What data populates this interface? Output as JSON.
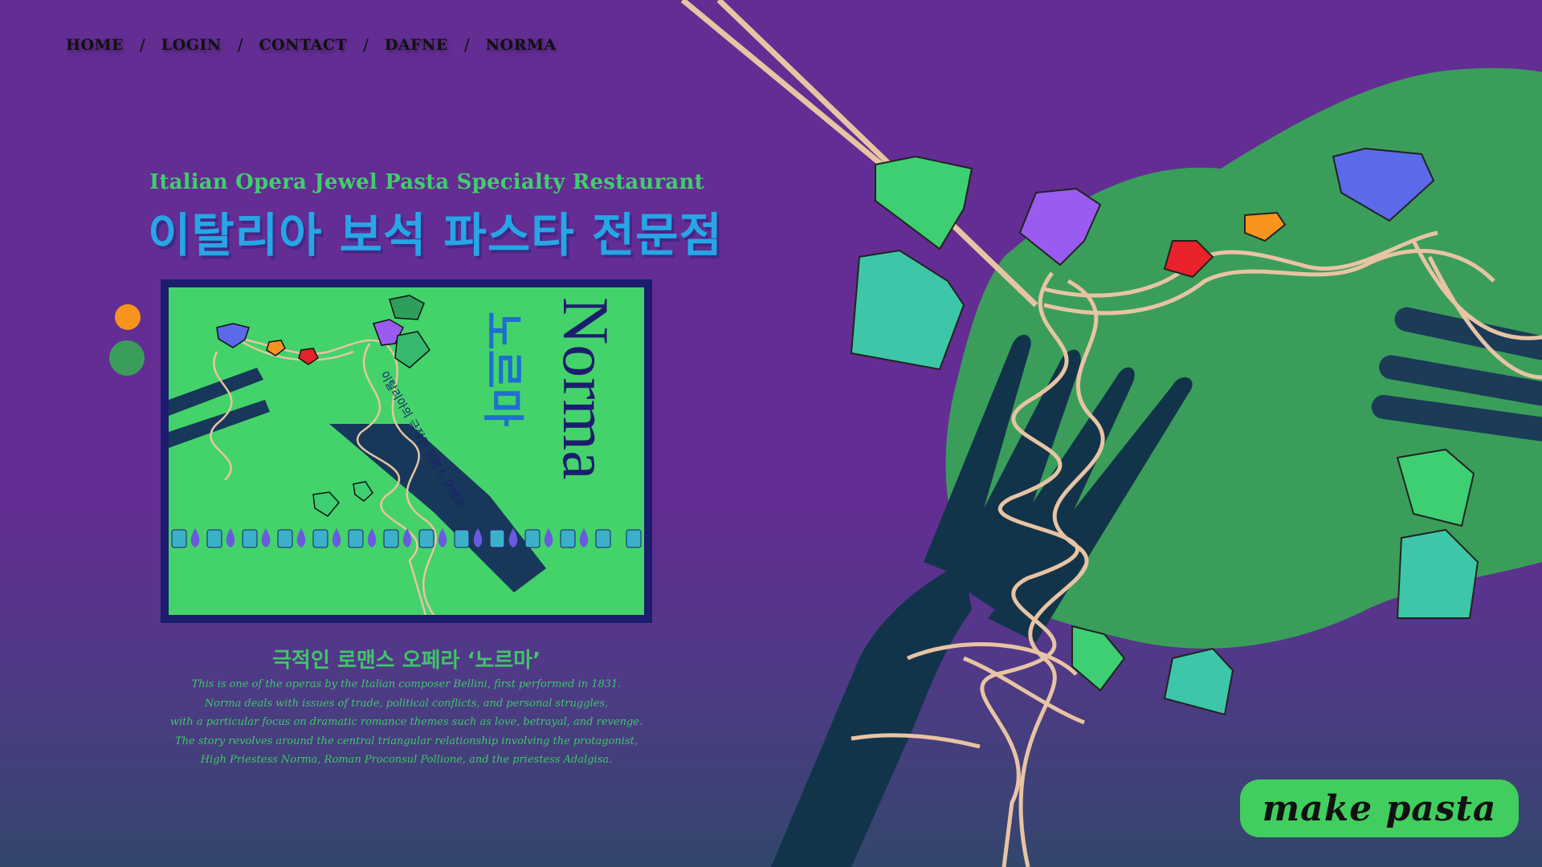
{
  "nav": {
    "items": [
      {
        "label": "HOME"
      },
      {
        "label": "LOGIN"
      },
      {
        "label": "CONTACT"
      },
      {
        "label": "DAFNE"
      },
      {
        "label": "NORMA"
      }
    ],
    "separator": "/"
  },
  "hero": {
    "subtitle_en": "Italian Opera Jewel Pasta Specialty Restaurant",
    "title_ko": "이탈리아 보석 파스타 전문점"
  },
  "poster": {
    "title_latin": "Norma",
    "title_ko": "노르마",
    "tagline_ko": "이탈리아의 극적인 로맨스 오페라"
  },
  "description": {
    "title": "극적인 로맨스 오페라 ‘노르마’",
    "lines": [
      "This is one of the operas by the Italian composer Bellini, first performed in 1831.",
      "Norma deals with issues of trade, political conflicts, and personal struggles,",
      "with a particular focus on dramatic romance themes such as love, betrayal, and revenge.",
      "The story revolves around the central triangular relationship involving the protagonist,",
      "High Priestess Norma, Roman Proconsul Pollione, and the priestess Adalgisa."
    ]
  },
  "cta": {
    "label": "make pasta"
  },
  "colors": {
    "background": "#632d93",
    "accent_green": "#42cd5f",
    "title_blue": "#27a6e6",
    "navy": "#1c1d6e",
    "blob_green": "#3a9e5a",
    "orange": "#f7941d"
  },
  "icons": [
    "gem-icon",
    "fork-icon",
    "noodle-icon",
    "chopsticks-icon"
  ]
}
